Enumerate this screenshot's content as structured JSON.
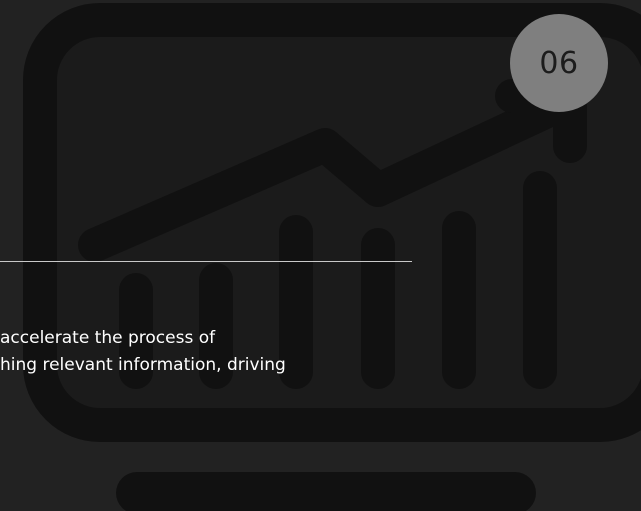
{
  "badge": {
    "number": "06"
  },
  "body": {
    "lines": [
      "accelerate the process of",
      "hing relevant information, driving"
    ]
  },
  "colors": {
    "background": "#222222",
    "illustration_fill": "#1b1b1b",
    "illustration_stroke": "#111111",
    "badge": "#7f7f7f",
    "text": "#ffffff",
    "divider": "#c9c9c9"
  },
  "icons": {
    "background": "monitor-growth-chart-icon"
  }
}
